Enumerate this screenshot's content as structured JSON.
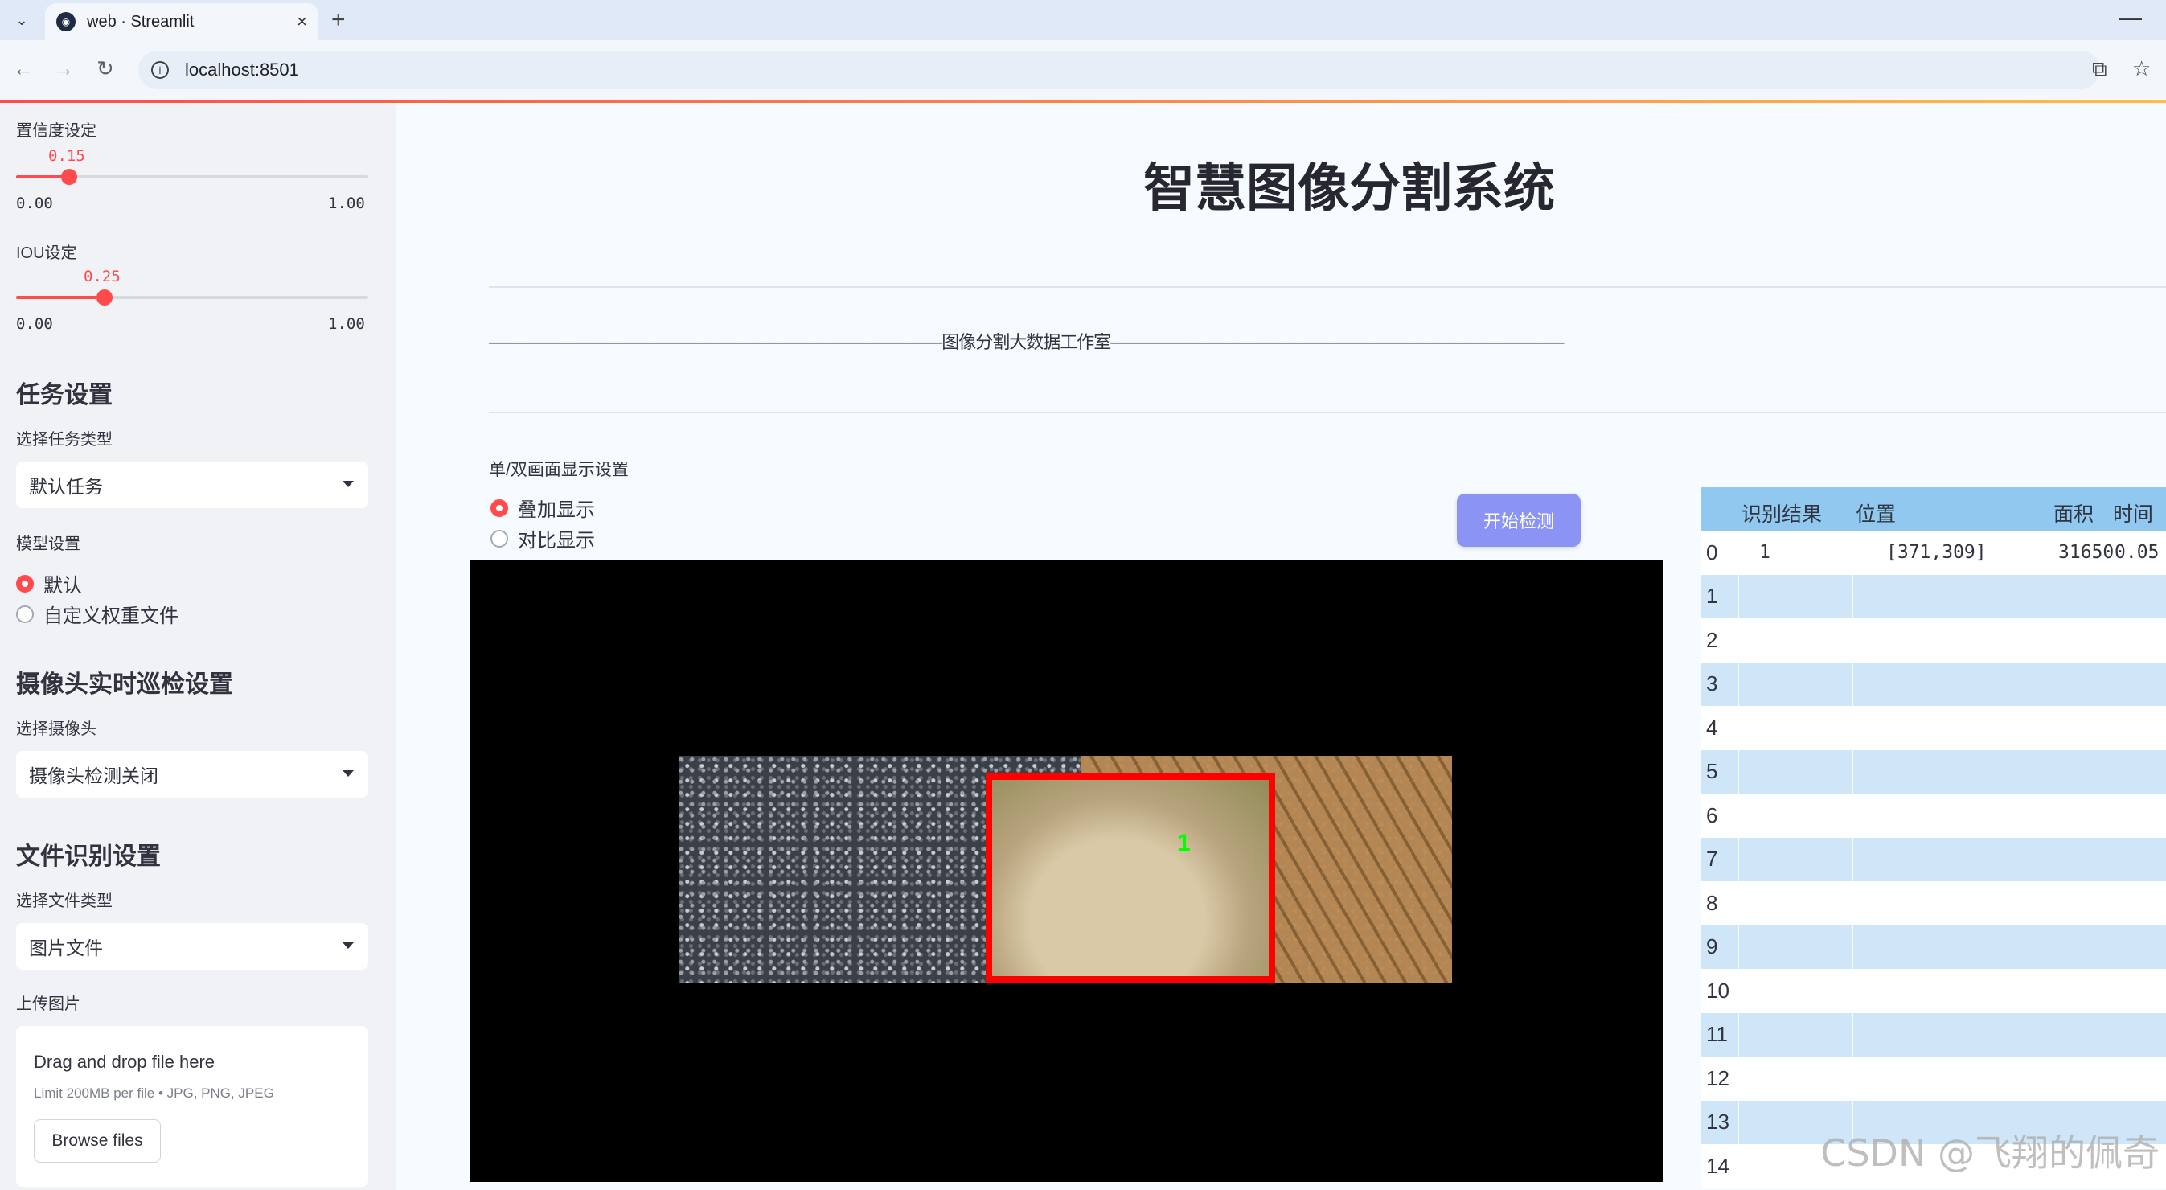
{
  "browser": {
    "tab_title": "web · Streamlit",
    "url": "localhost:8501",
    "new_tab": "+",
    "close": "×",
    "minimize": "—"
  },
  "sidebar": {
    "confidence": {
      "label": "置信度设定",
      "value": "0.15",
      "min": "0.00",
      "max": "1.00",
      "fraction": 0.15
    },
    "iou": {
      "label": "IOU设定",
      "value": "0.25",
      "min": "0.00",
      "max": "1.00",
      "fraction": 0.25
    },
    "task_header": "任务设置",
    "task_type_label": "选择任务类型",
    "task_type_value": "默认任务",
    "model_label": "模型设置",
    "model_options": [
      "默认",
      "自定义权重文件"
    ],
    "camera_header": "摄像头实时巡检设置",
    "camera_label": "选择摄像头",
    "camera_value": "摄像头检测关闭",
    "file_header": "文件识别设置",
    "file_type_label": "选择文件类型",
    "file_type_value": "图片文件",
    "upload_label": "上传图片",
    "upload_title": "Drag and drop file here",
    "upload_sub": "Limit 200MB per file • JPG, PNG, JPEG",
    "upload_button": "Browse files"
  },
  "main": {
    "title": "智慧图像分割系统",
    "studio_line": "——————————————————————————————————————————————图像分割大数据工作室——————————————————————————————————————————————",
    "display_label": "单/双画面显示设置",
    "display_options": [
      "叠加显示",
      "对比显示"
    ],
    "detect_button": "开始检测",
    "bbox_label": "1"
  },
  "table": {
    "headers": [
      "识别结果",
      "位置",
      "面积",
      "时间"
    ],
    "row_indices": [
      "0",
      "1",
      "2",
      "3",
      "4",
      "5",
      "6",
      "7",
      "8",
      "9",
      "10",
      "11",
      "12",
      "13",
      "14"
    ],
    "row0": {
      "result": "1",
      "position": "[371,309]",
      "area": "31650",
      "time": "0.05"
    }
  },
  "watermark": "CSDN @飞翔的佩奇"
}
